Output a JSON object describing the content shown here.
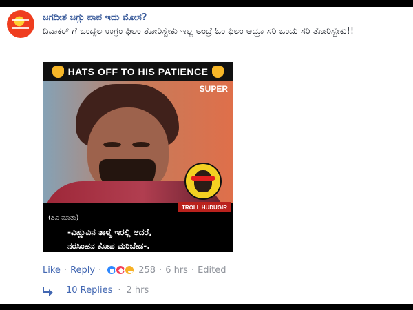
{
  "comment": {
    "author": "ಜಗದೀಶ ಜಗ್ಗು ಪಾಪ ಇದು ಮೋಸ?",
    "text": "ದಿವಾಕರ್ ಗೆ ಒಂದ್ಸಲ ಉಗ್ರಂ ಫಿಲಂ ತೋರಿಸ್ಬೇಕು ಇಲ್ಲ ಅಂದ್ರೆ ಓಂ ಫಿಲಂ ಅದ್ರೂ ಸರಿ ಒಂದು ಸರಿ ತೋರಿಸ್ಬೇಕು!!"
  },
  "meme": {
    "header": "HATS OFF TO HIS PATIENCE",
    "super_tag": "SUPER",
    "troll_label": "TROLL HUDUGIR ADDA",
    "speaker_label": "(ಶಿವಿ ಮಾತು)",
    "caption_line_1": "-ವಿಷ್ಣುವಿನ ತಾಳ್ಮೆ ಇರಲ್ಲಿ ಆದರೆ,",
    "caption_line_2": "ನರಸಿಂಹನ ಕೋಪ ಮರಿಬೇಡ-."
  },
  "actions": {
    "like": "Like",
    "separator_1": "·",
    "reply": "Reply",
    "separator_2": "·",
    "reaction_count": "258",
    "separator_3": "·",
    "time": "6 hrs",
    "separator_4": "·",
    "edited": "Edited"
  },
  "replies": {
    "count_label": "10 Replies",
    "separator": "·",
    "time": "2 hrs"
  },
  "icons": {
    "avatar": "profile-avatar-icon",
    "hands": "folded-hands-icon",
    "like": "like-reaction-icon",
    "love": "love-reaction-icon",
    "haha": "haha-reaction-icon",
    "reply": "reply-arrow-icon"
  },
  "colors": {
    "link_blue": "#4267b2",
    "muted_gray": "#90949c",
    "meme_red": "#ba221d",
    "logo_yellow": "#f3d022"
  }
}
